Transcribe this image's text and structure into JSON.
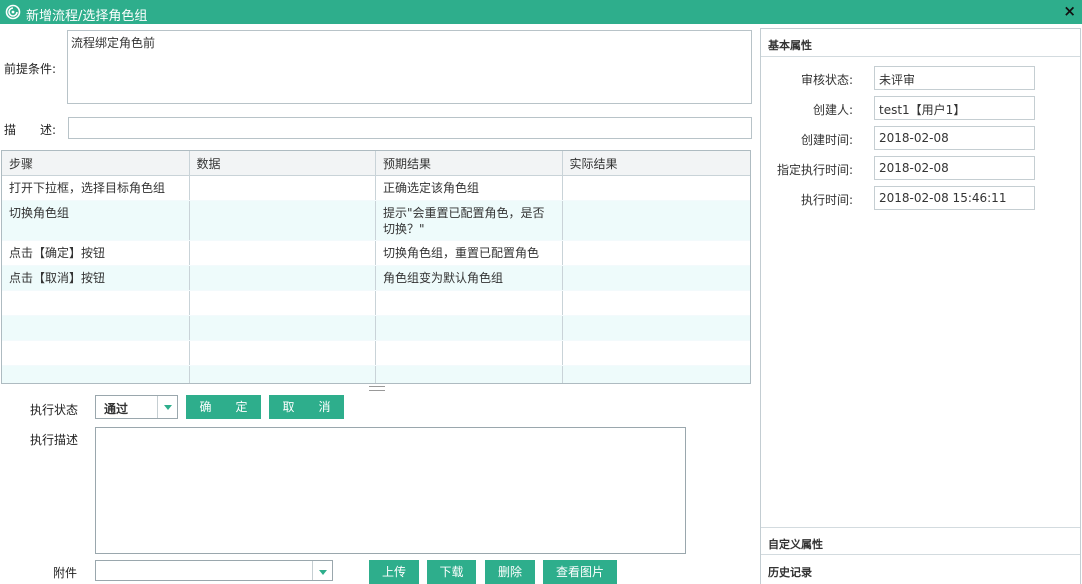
{
  "window": {
    "title": "新增流程/选择角色组",
    "close": "×"
  },
  "precondition": {
    "label": "前提条件:",
    "value": "流程绑定角色前"
  },
  "description": {
    "label": "描　　述:",
    "value": ""
  },
  "steps_table": {
    "columns": [
      "步骤",
      "数据",
      "预期结果",
      "实际结果"
    ],
    "rows": [
      [
        "打开下拉框，选择目标角色组",
        "",
        "正确选定该角色组",
        ""
      ],
      [
        "切换角色组",
        "",
        "提示\"会重置已配置角色，是否切换？\"",
        ""
      ],
      [
        "点击【确定】按钮",
        "",
        "切换角色组，重置已配置角色",
        ""
      ],
      [
        "点击【取消】按钮",
        "",
        "角色组变为默认角色组",
        ""
      ]
    ]
  },
  "exec": {
    "status_label": "执行状态",
    "status_value": "通过",
    "confirm_label": "确　　定",
    "cancel_label": "取　　消",
    "desc_label": "执行描述",
    "attach_label": "附件",
    "upload_label": "上传",
    "download_label": "下载",
    "delete_label": "删除",
    "view_image_label": "查看图片"
  },
  "side_panel": {
    "basic_title": "基本属性",
    "custom_title": "自定义属性",
    "history_title": "历史记录",
    "props": [
      {
        "label": "审核状态:",
        "value": "未评审"
      },
      {
        "label": "创建人:",
        "value": "test1【用户1】"
      },
      {
        "label": "创建时间:",
        "value": "2018-02-08"
      },
      {
        "label": "指定执行时间:",
        "value": "2018-02-08"
      },
      {
        "label": "执行时间:",
        "value": "2018-02-08 15:46:11"
      }
    ]
  },
  "colors": {
    "accent": "#2eae8c",
    "row_alt": "#eefbfb"
  }
}
